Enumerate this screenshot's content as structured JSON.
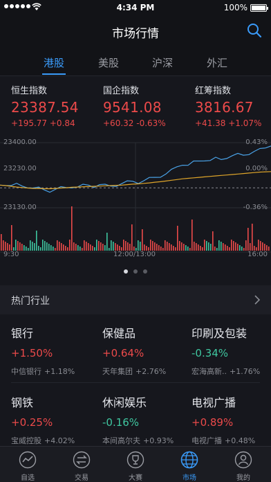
{
  "status": {
    "time": "4:34 PM",
    "battery": "100%"
  },
  "header": {
    "title": "市场行情"
  },
  "tabs": [
    {
      "label": "港股",
      "active": true
    },
    {
      "label": "美股",
      "active": false
    },
    {
      "label": "沪深",
      "active": false
    },
    {
      "label": "外汇",
      "active": false
    }
  ],
  "indices": [
    {
      "name": "恒生指数",
      "value": "23387.54",
      "change": "+195.77",
      "pct": "+0.84"
    },
    {
      "name": "国企指数",
      "value": "9541.08",
      "change": "+60.32",
      "pct": "-0.63%"
    },
    {
      "name": "红筹指数",
      "value": "3816.67",
      "change": "+41.38",
      "pct": "+1.07%"
    }
  ],
  "chart": {
    "left_labels": [
      "23400.00",
      "23230.00",
      "23130.00"
    ],
    "right_labels": [
      "0.43%",
      "0.00%",
      "-0.36%"
    ],
    "time_labels": [
      "9:30",
      "12:00/13:00",
      "16:00"
    ],
    "colors": {
      "price": "#4aa3e8",
      "average": "#e0a62a",
      "up": "#ec4a4a",
      "down": "#3fc7a0"
    }
  },
  "chart_data": {
    "type": "line",
    "title": "",
    "x": [
      "9:30",
      "12:00/13:00",
      "16:00"
    ],
    "ylim": [
      23130.0,
      23400.0
    ],
    "right_axis": [
      "0.43%",
      "0.00%",
      "-0.36%"
    ],
    "series": [
      {
        "values": [
          23224,
          23228,
          23222,
          23226,
          23220,
          23218,
          23212,
          23210,
          23204,
          23200,
          23206,
          23212,
          23214,
          23218,
          23216,
          23222,
          23224,
          23220,
          23226,
          23222,
          23220,
          23224,
          23230,
          23236,
          23240,
          23236,
          23242,
          23250,
          23256,
          23262,
          23270,
          23284,
          23300,
          23312,
          23306,
          23318,
          23324,
          23330,
          23326,
          23334,
          23330,
          23340,
          23346,
          23350,
          23348,
          23356,
          23364,
          23370,
          23378,
          23392
        ]
      },
      {
        "values": [
          23224,
          23222,
          23219,
          23216,
          23214,
          23212,
          23210,
          23210,
          23209,
          23209,
          23210,
          23212,
          23213,
          23215,
          23216,
          23217,
          23218,
          23219,
          23220,
          23221,
          23222,
          23223,
          23224,
          23226,
          23228,
          23229,
          23231,
          23233,
          23236,
          23238,
          23241,
          23244,
          23247,
          23250,
          23252,
          23254,
          23256,
          23258,
          23260,
          23262,
          23264,
          23266,
          23268,
          23270,
          23272,
          23274,
          23276,
          23278,
          23279,
          23280
        ]
      }
    ]
  },
  "pager": {
    "count": 3,
    "active": 0
  },
  "section": {
    "title": "热门行业"
  },
  "industries": [
    {
      "name": "银行",
      "pct": "+1.50%",
      "dir": "up",
      "leader": "中信银行",
      "leader_pct": "+1.18%"
    },
    {
      "name": "保健品",
      "pct": "+0.64%",
      "dir": "up",
      "leader": "天年集团",
      "leader_pct": "+2.76%"
    },
    {
      "name": "印刷及包装",
      "pct": "-0.34%",
      "dir": "down",
      "leader": "宏海高新..",
      "leader_pct": "+1.76%"
    },
    {
      "name": "钢铁",
      "pct": "+0.25%",
      "dir": "up",
      "leader": "宝威控股",
      "leader_pct": "+4.02%"
    },
    {
      "name": "休闲娱乐",
      "pct": "-0.16%",
      "dir": "down",
      "leader": "本间高尔夫",
      "leader_pct": "+0.93%"
    },
    {
      "name": "电视广播",
      "pct": "+0.89%",
      "dir": "up",
      "leader": "电视广播",
      "leader_pct": "+0.48%"
    }
  ],
  "tabbar": [
    {
      "label": "自选",
      "icon": "trend-icon",
      "active": false
    },
    {
      "label": "交易",
      "icon": "exchange-icon",
      "active": false
    },
    {
      "label": "大赛",
      "icon": "trophy-icon",
      "active": false
    },
    {
      "label": "市场",
      "icon": "globe-icon",
      "active": true
    },
    {
      "label": "我的",
      "icon": "user-icon",
      "active": false
    }
  ]
}
